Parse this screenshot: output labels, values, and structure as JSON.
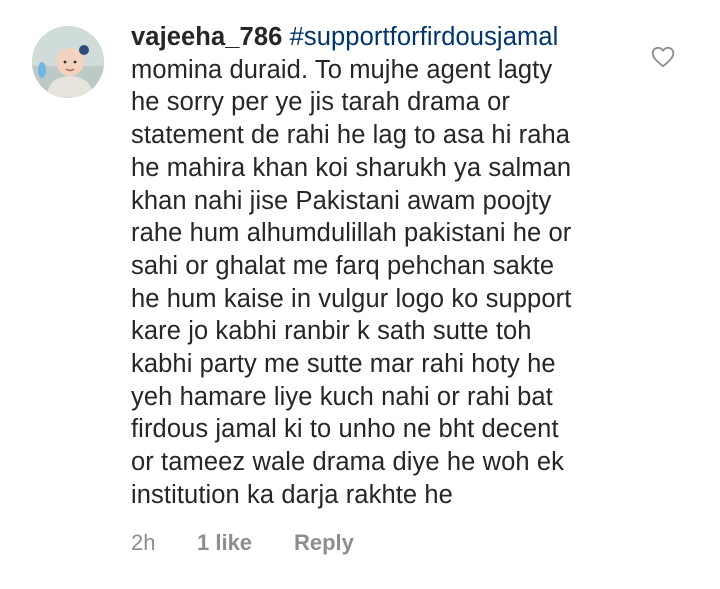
{
  "comment": {
    "username": "vajeeha_786",
    "hashtag": "#supportforfirdousjamal",
    "first_line_rest": "",
    "lines": [
      "momina duraid. To mujhe agent lagty",
      "he sorry per ye jis tarah drama or",
      "statement de rahi he lag to asa hi raha",
      "he mahira khan koi sharukh ya salman",
      "khan nahi jise Pakistani awam poojty",
      "rahe hum alhumdulillah pakistani he or",
      "sahi or ghalat me farq pehchan sakte",
      "he hum kaise in vulgur logo ko support",
      "kare jo kabhi ranbir k sath sutte toh",
      "kabhi party me sutte mar rahi hoty he",
      "yeh hamare liye kuch nahi or rahi bat",
      "firdous jamal ki to unho ne bht decent",
      "or tameez wale drama diye he woh ek",
      "institution ka darja rakhte he"
    ],
    "timestamp": "2h",
    "likes_label": "1 like",
    "reply_label": "Reply",
    "avatar_icon": "profile-photo-icon",
    "like_icon": "heart-outline-icon"
  },
  "colors": {
    "text": "#262626",
    "hashtag": "#003569",
    "meta": "#8e8e8e",
    "heart": "#8e8e8e"
  }
}
